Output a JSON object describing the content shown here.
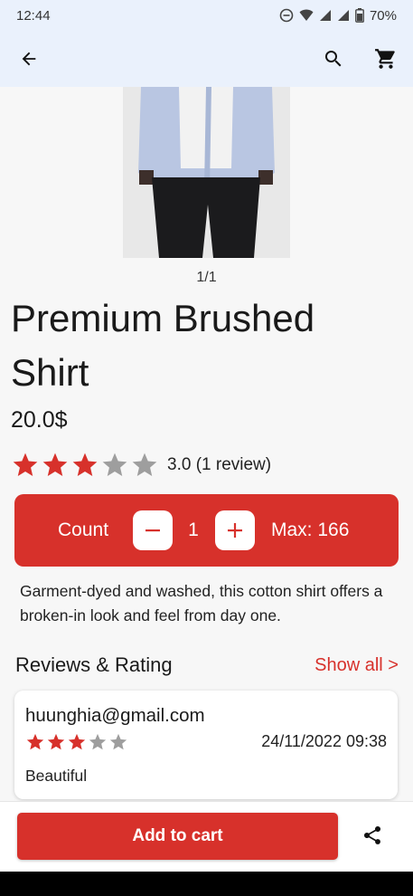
{
  "status_bar": {
    "time": "12:44",
    "battery": "70%",
    "icons": [
      "do-not-disturb-icon",
      "wifi-icon",
      "signal-icon",
      "signal-icon",
      "battery-icon"
    ]
  },
  "app_bar": {
    "back_icon": "arrow-left-icon",
    "search_icon": "search-icon",
    "cart_icon": "cart-icon"
  },
  "product": {
    "image_counter": "1/1",
    "title": "Premium Brushed Shirt",
    "price": "20.0$",
    "rating_value": 3,
    "rating_max": 5,
    "rating_text": "3.0 (1 review)",
    "description": "Garment-dyed and washed, this cotton shirt offers a broken-in look and feel from day one."
  },
  "quantity": {
    "label": "Count",
    "minus_symbol": "−",
    "value": "1",
    "plus_symbol": "+",
    "max_label": "Max: 166"
  },
  "reviews": {
    "title": "Reviews & Rating",
    "show_all": "Show all >",
    "items": [
      {
        "user": "huunghia@gmail.com",
        "rating": 3,
        "date": "24/11/2022 09:38",
        "text": "Beautiful"
      }
    ]
  },
  "bottom": {
    "add_to_cart": "Add to cart",
    "share_icon": "share-icon"
  },
  "colors": {
    "accent": "#d7312b",
    "app_bar_bg": "#eaf1fc",
    "star_empty": "#9e9e9e"
  }
}
